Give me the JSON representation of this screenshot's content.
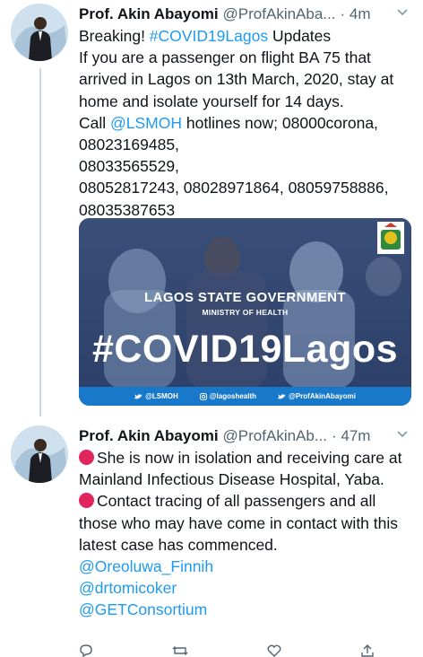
{
  "tweets": [
    {
      "author": "Prof. Akin Abayomi",
      "handle": "@ProfAkinAba...",
      "time": "· 4m",
      "avatar_icon": "profile-photo-icon",
      "lines": {
        "l1_prefix": "Breaking! ",
        "l1_hashtag": "#COVID19Lagos",
        "l1_suffix": " Updates",
        "l2": "If you are a passenger on flight BA 75 that arrived in Lagos on 13th March, 2020, stay at home and isolate yourself for 14 days.",
        "call_prefix": "Call ",
        "call_mention": "@LSMOH",
        "call_suffix": " hotlines now; 08000corona,",
        "phone1": "08023169485,",
        "phone2": "08033565529,",
        "phone3": "08052817243, 08028971864, 08059758886,",
        "phone4": "08035387653"
      },
      "media": {
        "title": "LAGOS STATE GOVERNMENT",
        "subtitle": "MINISTRY OF HEALTH",
        "hashtag": "#COVID19Lagos",
        "footer": [
          "@LSMOH",
          "@lagoshealth",
          "@ProfAkinAbayomi"
        ]
      }
    },
    {
      "author": "Prof. Akin Abayomi",
      "handle": "@ProfAkinAb...",
      "time": "· 47m",
      "avatar_icon": "profile-photo-icon",
      "lines": {
        "p1": "She is now in isolation and receiving care at Mainland Infectious Disease Hospital, Yaba.",
        "p2": "Contact tracing of all passengers and all those who may have come in contact with this latest case has commenced.",
        "m1": "@Oreoluwa_Finnih",
        "m2": "@drtomicoker",
        "m3": "@GETConsortium"
      }
    }
  ],
  "colors": {
    "link": "#1d9bf0",
    "red_circle": "#e0245e",
    "banner_blue": "#1878c9"
  }
}
